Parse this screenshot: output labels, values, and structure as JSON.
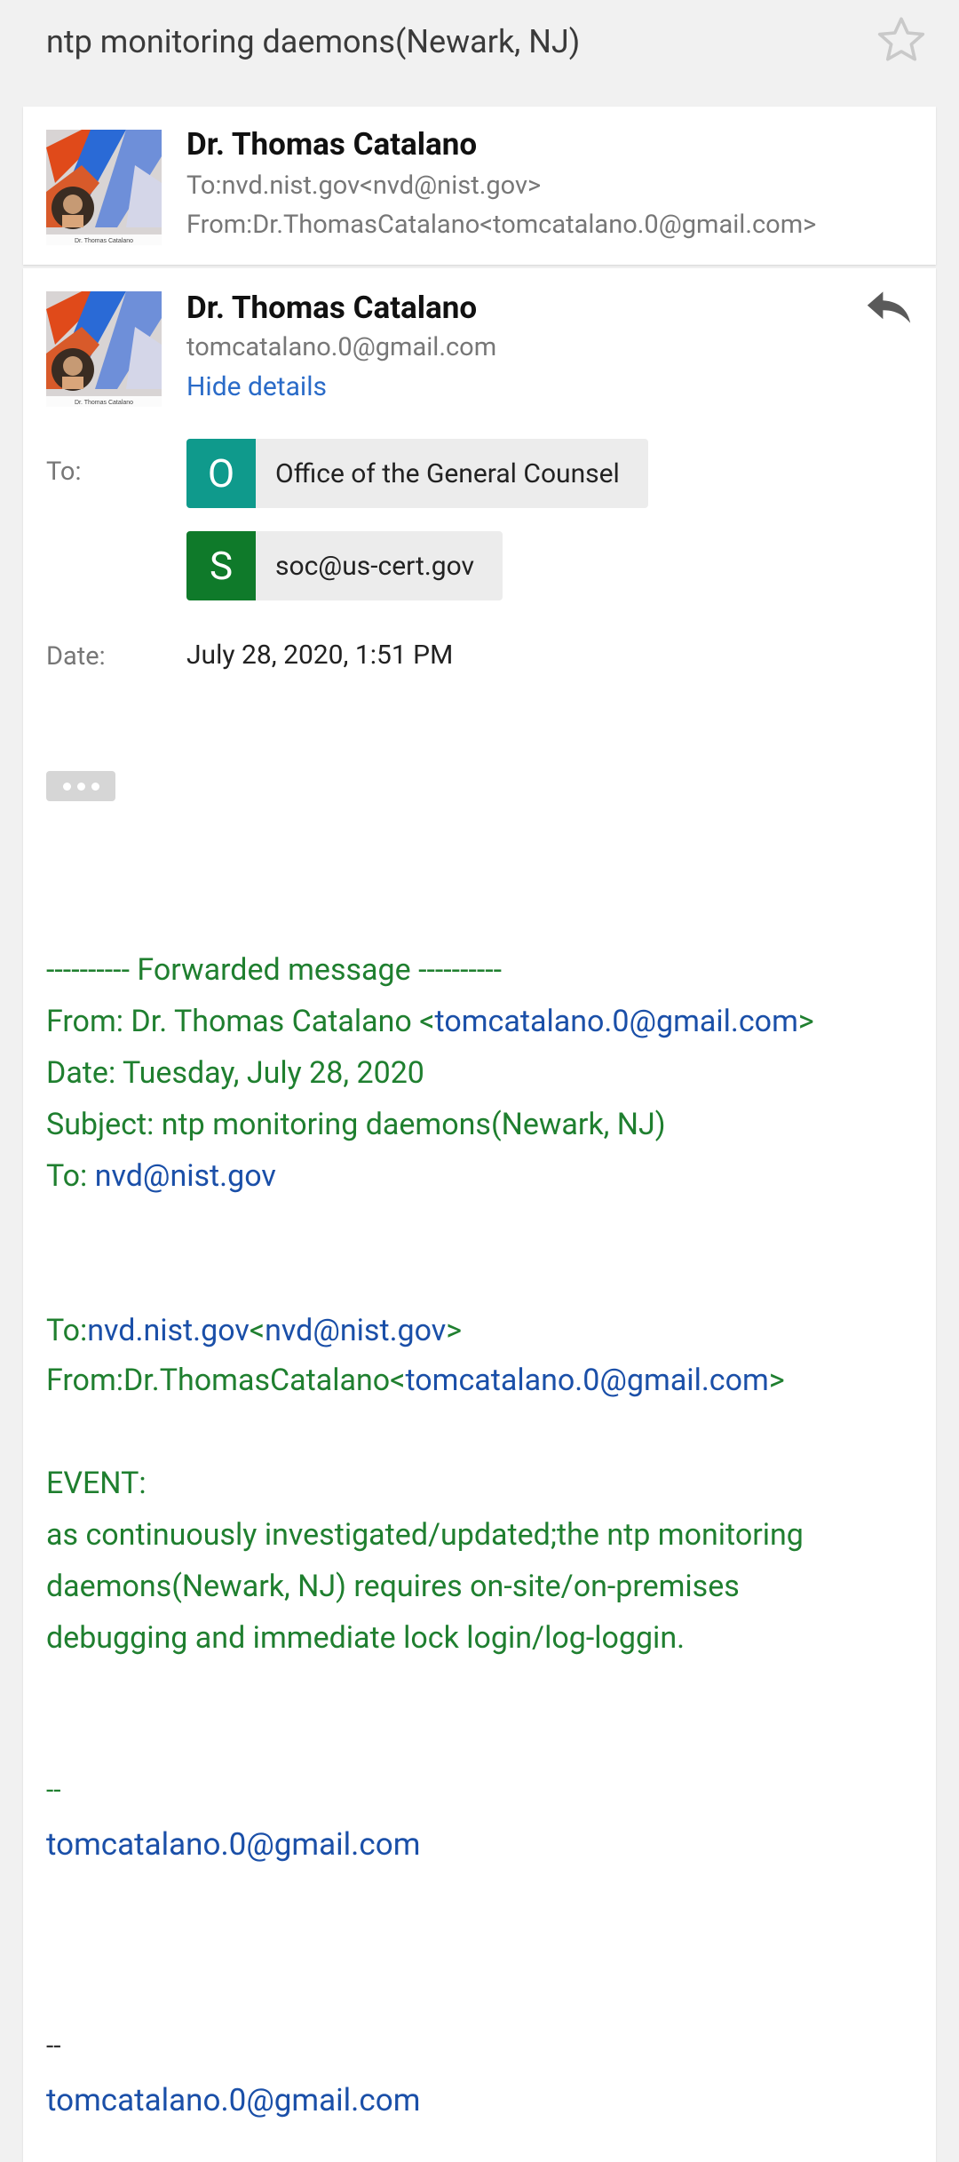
{
  "subject": "ntp monitoring daemons(Newark, NJ)",
  "collapsed_message": {
    "sender_name": "Dr. Thomas Catalano",
    "to_line": "To:nvd.nist.gov<nvd@nist.gov>",
    "from_line": "From:Dr.ThomasCatalano<tomcatalano.0@gmail.com>"
  },
  "expanded_message": {
    "sender_name": "Dr. Thomas Catalano",
    "sender_email": "tomcatalano.0@gmail.com",
    "hide_details": "Hide details",
    "to_label": "To:",
    "recipients": [
      {
        "initial": "O",
        "name": "Office of the General Counsel",
        "color": "#0f9a8c"
      },
      {
        "initial": "S",
        "name": "soc@us-cert.gov",
        "color": "#0f7a2a"
      }
    ],
    "date_label": "Date:",
    "date_value": "July 28, 2020, 1:51 PM"
  },
  "body": {
    "forward_header": "---------- Forwarded message ----------",
    "from_prefix": "From: Dr. Thomas Catalano <",
    "from_email": "tomcatalano.0@gmail.com",
    "from_suffix": ">",
    "date_line": "Date: Tuesday, July 28, 2020",
    "subject_line": "Subject: ntp monitoring daemons(Newark, NJ)",
    "to_prefix": "To: ",
    "to_email": "nvd@nist.gov",
    "to2_prefix": "To:",
    "to2_host": "nvd.nist.gov",
    "to2_lt": "<",
    "to2_email": "nvd@nist.gov",
    "to2_gt": ">",
    "from2_prefix": "From:Dr.ThomasCatalano<",
    "from2_email": "tomcatalano.0@gmail.com",
    "from2_gt": ">",
    "event_label": "EVENT:",
    "event_lines": [
      "as continuously investigated/updated;the ntp monitoring",
      "daemons(Newark, NJ) requires on-site/on-premises",
      "debugging and immediate lock login/log-loggin."
    ],
    "sig1_dash": "--",
    "sig1_email": "tomcatalano.0@gmail.com",
    "sig2_dash": "--",
    "sig2_email": "tomcatalano.0@gmail.com"
  },
  "avatar_caption": "Dr. Thomas Catalano"
}
